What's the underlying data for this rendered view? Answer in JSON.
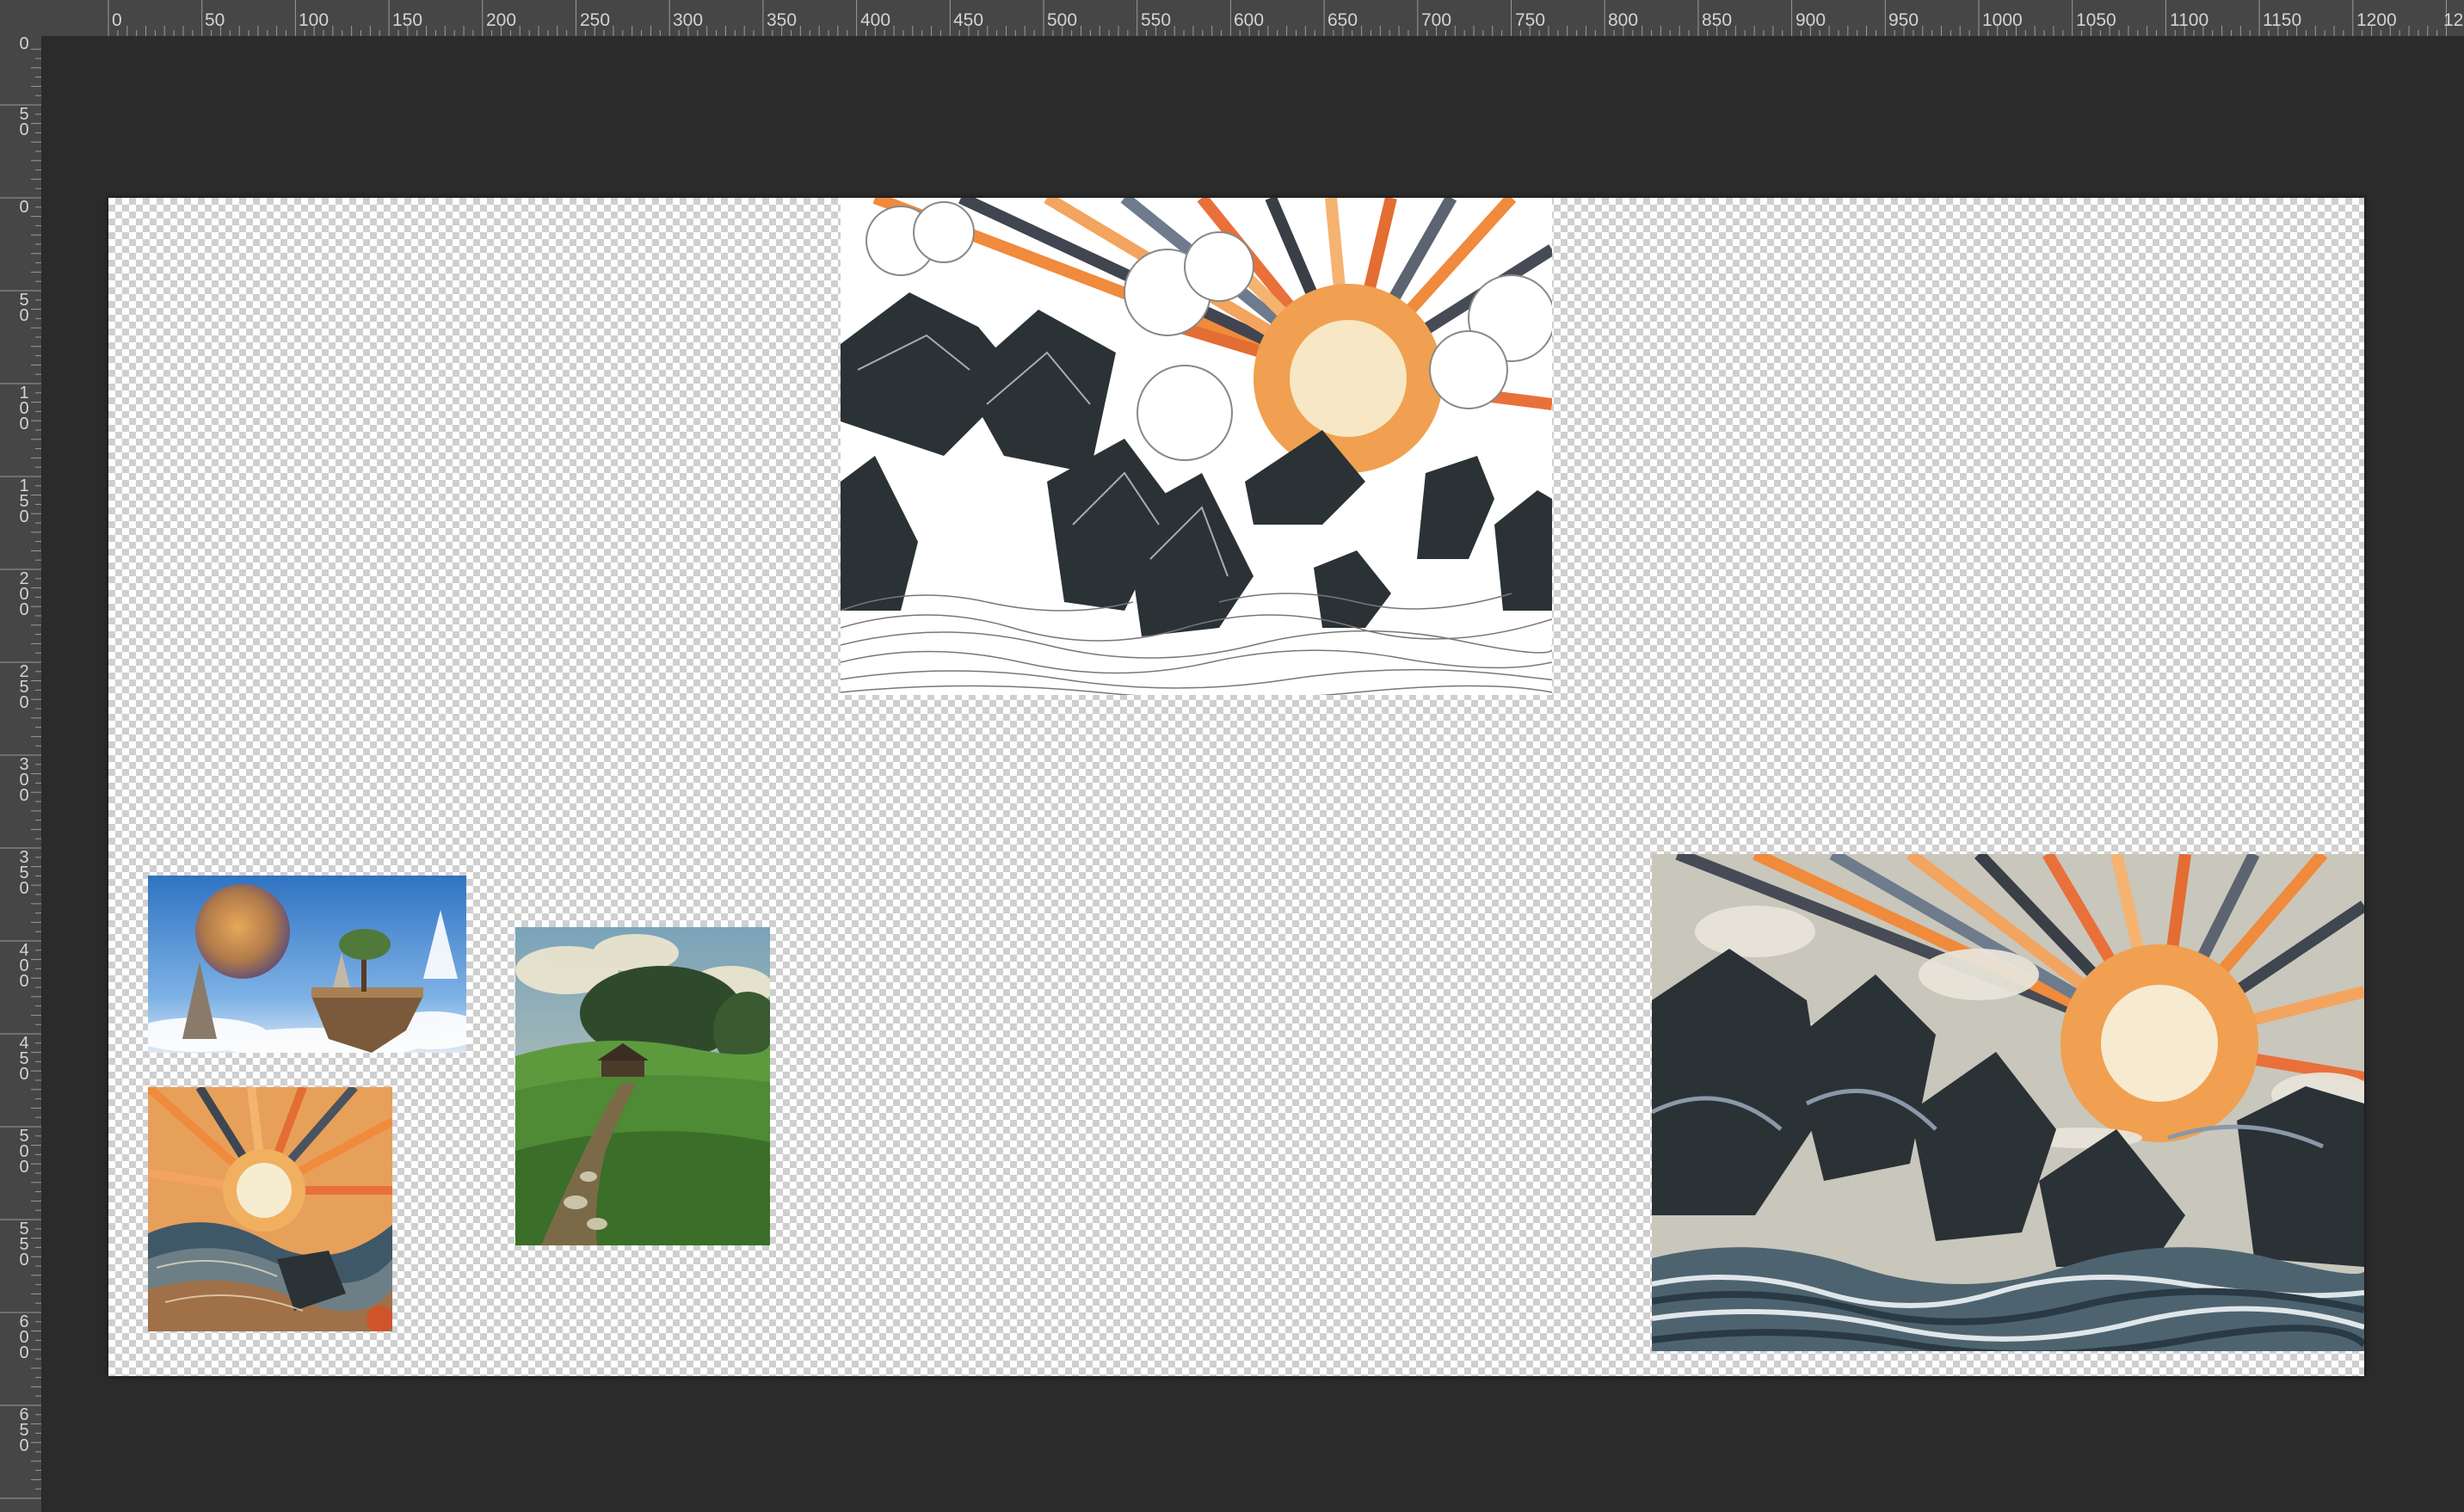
{
  "rulers": {
    "horizontal": [
      "0",
      "50",
      "100",
      "150",
      "200",
      "250",
      "300",
      "350",
      "400",
      "450",
      "500",
      "550",
      "600",
      "650",
      "700",
      "750",
      "800",
      "850",
      "900",
      "950",
      "1000",
      "1050",
      "1100",
      "1150",
      "1200",
      "12"
    ],
    "vertical": [
      "0",
      "50",
      "0",
      "50",
      "100",
      "150",
      "200",
      "250",
      "300",
      "350",
      "400",
      "450",
      "500",
      "550",
      "600",
      "650"
    ]
  },
  "canvas": {
    "background": "transparent-checkerboard",
    "layers": [
      {
        "name": "sunburst-mountains-line-art",
        "description_icon": "image-layer"
      },
      {
        "name": "floating-island-planet",
        "description_icon": "image-layer"
      },
      {
        "name": "sunset-swirl-landscape",
        "description_icon": "image-layer"
      },
      {
        "name": "green-field-path-cottage",
        "description_icon": "image-layer"
      },
      {
        "name": "sunburst-mountains-color",
        "description_icon": "image-layer"
      }
    ]
  },
  "colors": {
    "workspace": "#2b2b2b",
    "ruler": "#464646",
    "ruler_text": "#d4d4d4",
    "sun_orange": "#f08a3c",
    "mountain_dark": "#2a3236"
  }
}
